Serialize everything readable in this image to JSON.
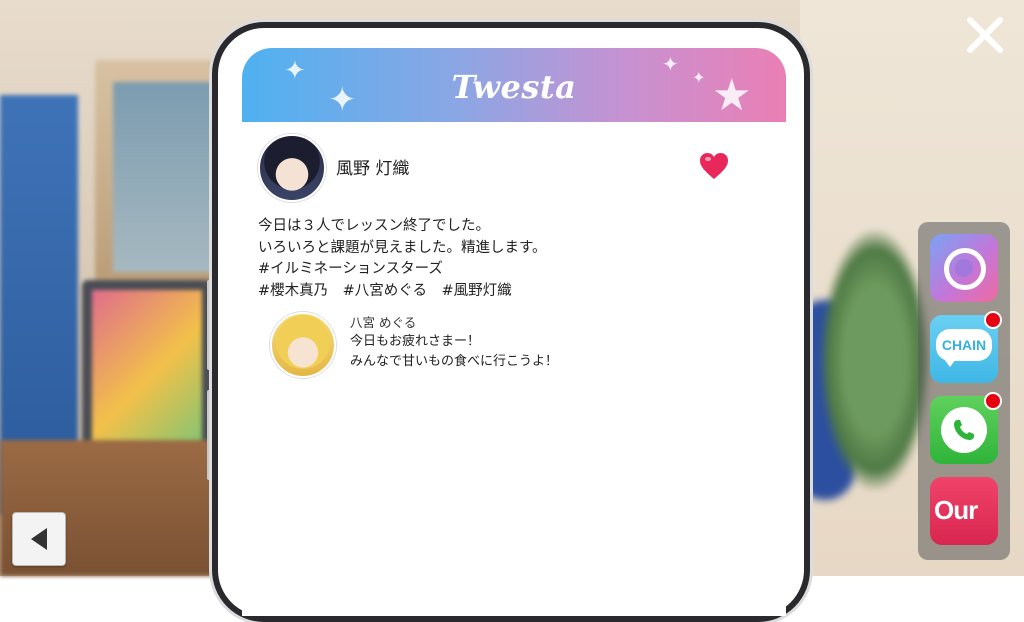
{
  "app": {
    "logo_text": "Twesta",
    "close_icon": "close-icon",
    "back_icon": "back-arrow-icon"
  },
  "post": {
    "author": "風野 灯織",
    "liked": true,
    "lines": [
      "今日は３人でレッスン終了でした。",
      "いろいろと課題が見えました。精進します。",
      "#イルミネーションスターズ",
      "#櫻木真乃　#八宮めぐる　#風野灯織"
    ]
  },
  "reply": {
    "author": "八宮 めぐる",
    "lines": [
      "今日もお疲れさまー！",
      "みんなで甘いもの食べに行こうよ！"
    ]
  },
  "dock": {
    "apps": [
      {
        "name": "camera",
        "icon": "camera-ring-icon",
        "badge": false
      },
      {
        "name": "chain",
        "label": "CHAIN",
        "badge": true
      },
      {
        "name": "phone",
        "icon": "phone-handset-icon",
        "badge": true
      },
      {
        "name": "our",
        "label": "Our",
        "badge": false
      }
    ]
  },
  "colors": {
    "header_gradient": [
      "#4fb1f0",
      "#c692d2",
      "#ea7fb5"
    ],
    "heart": "#e8285a",
    "badge": "#e60012"
  }
}
